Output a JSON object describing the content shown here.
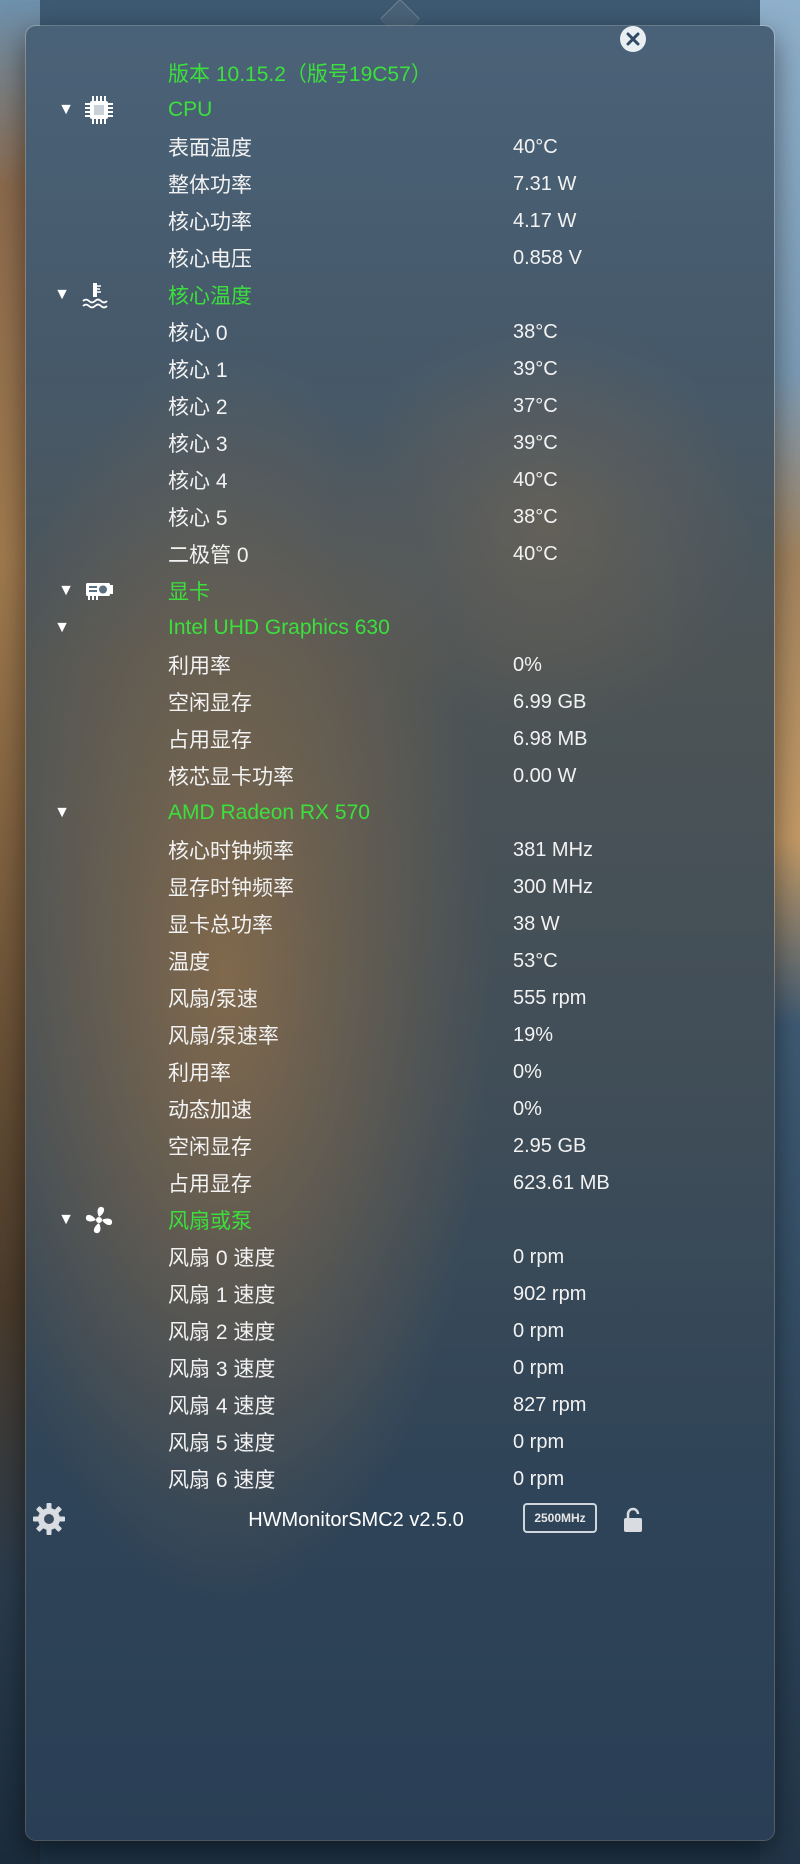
{
  "version_line": "版本 10.15.2（版号19C57）",
  "sections": {
    "cpu": {
      "title": "CPU",
      "rows": [
        {
          "label": "表面温度",
          "value": "40°C"
        },
        {
          "label": "整体功率",
          "value": "7.31 W"
        },
        {
          "label": "核心功率",
          "value": "4.17 W"
        },
        {
          "label": "核心电压",
          "value": "0.858 V"
        }
      ],
      "core_temp": {
        "title": "核心温度",
        "rows": [
          {
            "label": "核心 0",
            "value": "38°C"
          },
          {
            "label": "核心 1",
            "value": "39°C"
          },
          {
            "label": "核心 2",
            "value": "37°C"
          },
          {
            "label": "核心 3",
            "value": "39°C"
          },
          {
            "label": "核心 4",
            "value": "40°C"
          },
          {
            "label": "核心 5",
            "value": "38°C"
          },
          {
            "label": "二极管 0",
            "value": "40°C"
          }
        ]
      }
    },
    "gpu": {
      "title": "显卡",
      "intel": {
        "title": "Intel UHD Graphics 630",
        "rows": [
          {
            "label": "利用率",
            "value": "0%"
          },
          {
            "label": "空闲显存",
            "value": "6.99 GB"
          },
          {
            "label": "占用显存",
            "value": "6.98 MB"
          },
          {
            "label": "核芯显卡功率",
            "value": "0.00 W"
          }
        ]
      },
      "amd": {
        "title": "AMD Radeon RX 570",
        "rows": [
          {
            "label": "核心时钟频率",
            "value": "381 MHz"
          },
          {
            "label": "显存时钟频率",
            "value": "300 MHz"
          },
          {
            "label": "显卡总功率",
            "value": "38 W"
          },
          {
            "label": "温度",
            "value": "53°C"
          },
          {
            "label": "风扇/泵速",
            "value": "555 rpm"
          },
          {
            "label": "风扇/泵速率",
            "value": "19%"
          },
          {
            "label": "利用率",
            "value": "0%"
          },
          {
            "label": "动态加速",
            "value": "0%"
          },
          {
            "label": "空闲显存",
            "value": "2.95 GB"
          },
          {
            "label": "占用显存",
            "value": "623.61 MB"
          }
        ]
      }
    },
    "fans": {
      "title": "风扇或泵",
      "rows": [
        {
          "label": "风扇 0 速度",
          "value": "0 rpm"
        },
        {
          "label": "风扇 1 速度",
          "value": "902 rpm"
        },
        {
          "label": "风扇 2 速度",
          "value": "0 rpm"
        },
        {
          "label": "风扇 3 速度",
          "value": "0 rpm"
        },
        {
          "label": "风扇 4 速度",
          "value": "827 rpm"
        },
        {
          "label": "风扇 5 速度",
          "value": "0 rpm"
        },
        {
          "label": "风扇 6 速度",
          "value": "0 rpm"
        }
      ]
    }
  },
  "footer": {
    "app_title": "HWMonitorSMC2 v2.5.0",
    "frequency_badge": "2500MHz"
  },
  "colors": {
    "header_green": "#3ce03c",
    "text_white": "#f2f2f2"
  },
  "icons": {
    "close": "close-icon",
    "cpu": "cpu-chip-icon",
    "core_temp": "thermometer-icon",
    "gpu": "graphics-card-icon",
    "fans": "fan-icon",
    "settings": "gear-icon",
    "lock": "lock-icon",
    "disclosure": "disclosure-triangle-icon"
  }
}
